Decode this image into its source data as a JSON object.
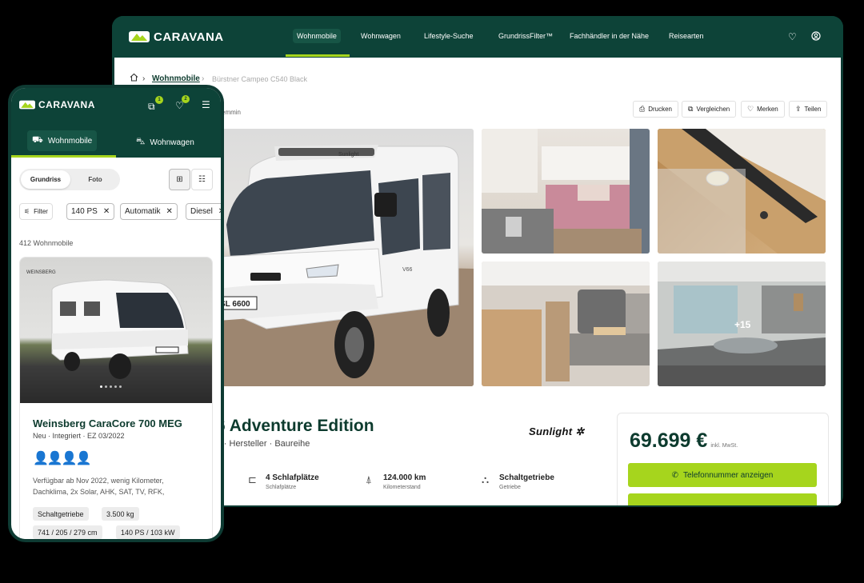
{
  "brand": {
    "name": "CARAVANA",
    "accent": "#a6d51d",
    "dark": "#0d4338"
  },
  "desktop": {
    "nav": [
      "Wohnmobile",
      "Wohnwagen",
      "Lifestyle-Suche",
      "GrundrissFilter™",
      "Fachhändler in der Nähe",
      "Reisearten"
    ],
    "icons": [
      "heart-icon",
      "user-icon"
    ],
    "breadcrumb": {
      "home": "home-icon",
      "link": "Wohnmobile",
      "current": "Bürstner Campeo C540 Black"
    },
    "location_partial": "emmin",
    "toolbar": {
      "print": "Drucken",
      "compare": "Vergleichen",
      "save": "Merken",
      "share": "Teilen"
    },
    "gallery_more": "+15",
    "title_partial": "6 Adventure Edition",
    "subtitle_partial": "rt · Hersteller · Baureihe",
    "brand_logo": "Sunlight",
    "specs": [
      {
        "value": "4 Schlafplätze",
        "label": "Schlafplätze"
      },
      {
        "value": "124.000 km",
        "label": "Kilometerstand"
      },
      {
        "value": "Schaltgetriebe",
        "label": "Getriebe"
      }
    ],
    "price": {
      "value": "69.699 €",
      "note": "inkl. MwSt.",
      "cta": "Telefonnummer anzeigen"
    }
  },
  "mobile": {
    "badges": [
      "1",
      "2"
    ],
    "tabs": [
      "Wohnmobile",
      "Wohnwagen"
    ],
    "segment": {
      "on": "Grundriss",
      "off": "Foto"
    },
    "filters": {
      "filter": "Filter",
      "chips": [
        "140 PS",
        "Automatik",
        "Diesel"
      ]
    },
    "count": "412 Wohnmobile",
    "card": {
      "image_label": "WEINSBERG",
      "title": "Weinsberg CaraCore 700 MEG",
      "subtitle": "Neu · Integriert · EZ 03/2022",
      "description": "Verfügbar ab Nov 2022, wenig Kilometer, Dachklima, 2x Solar, AHK, SAT, TV, RFK,",
      "tags": [
        "Schaltgetriebe",
        "3.500 kg",
        "741 / 205 / 279 cm",
        "140 PS / 103 kW"
      ]
    }
  }
}
